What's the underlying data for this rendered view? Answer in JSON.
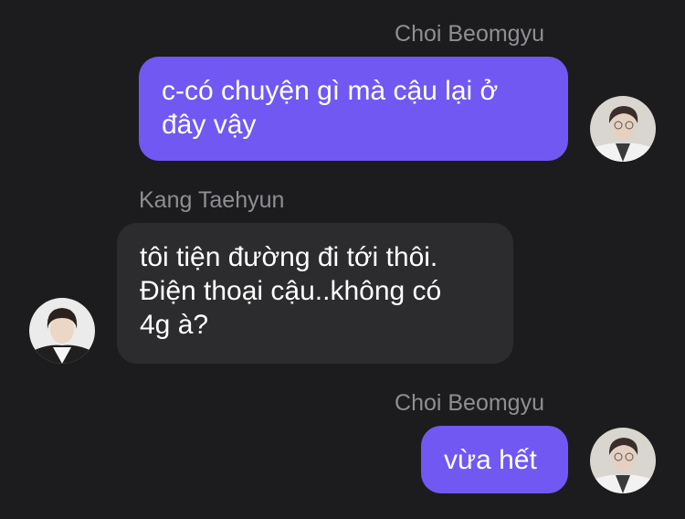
{
  "colors": {
    "background": "#1c1c1e",
    "sender_name": "#8e8e93",
    "outgoing_bubble": "#7158f2",
    "incoming_bubble": "#2c2c2e",
    "message_text": "#ffffff"
  },
  "messages": [
    {
      "sender": "Choi Beomgyu",
      "text": "c-có chuyện gì mà cậu lại ở\nđây vậy",
      "side": "right",
      "avatar": "beomgyu-avatar"
    },
    {
      "sender": "Kang Taehyun",
      "text": "tôi tiện đường đi tới thôi.\nĐiện thoại cậu..không có\n4g à?",
      "side": "left",
      "avatar": "taehyun-avatar"
    },
    {
      "sender": "Choi Beomgyu",
      "text": "vừa hết",
      "side": "right",
      "avatar": "beomgyu-avatar"
    }
  ]
}
